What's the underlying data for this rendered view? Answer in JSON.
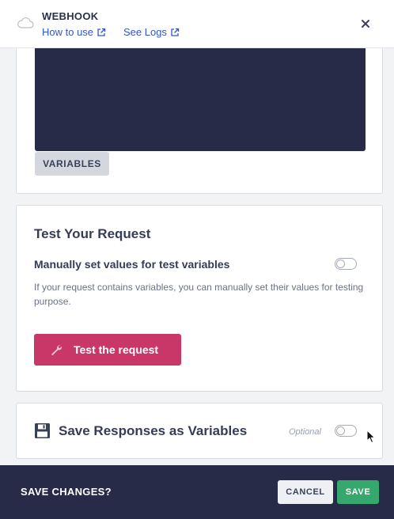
{
  "header": {
    "title": "WEBHOOK",
    "links": {
      "how_to_use": "How to use",
      "see_logs": "See Logs"
    },
    "icons": {
      "logo": "cloud-icon",
      "close": "close-icon",
      "external": "external-link-icon"
    }
  },
  "editor_panel": {
    "variables_label": "VARIABLES"
  },
  "test_panel": {
    "title": "Test Your Request",
    "toggle_label": "Manually set values for test variables",
    "toggle_on": false,
    "help_text": "If your request contains variables, you can manually set their values for testing purpose.",
    "button_label": "Test the request",
    "button_icon": "wrench-icon"
  },
  "save_responses_panel": {
    "icon": "floppy-disk-icon",
    "title": "Save Responses as Variables",
    "optional_label": "Optional",
    "toggle_on": false
  },
  "footer": {
    "prompt": "SAVE CHANGES?",
    "cancel_label": "CANCEL",
    "save_label": "SAVE"
  },
  "colors": {
    "editor_bg": "#282b47",
    "footer_bg": "#282b47",
    "primary_button": "#c93768",
    "save_button": "#36a86d",
    "link": "#2f56c9"
  }
}
